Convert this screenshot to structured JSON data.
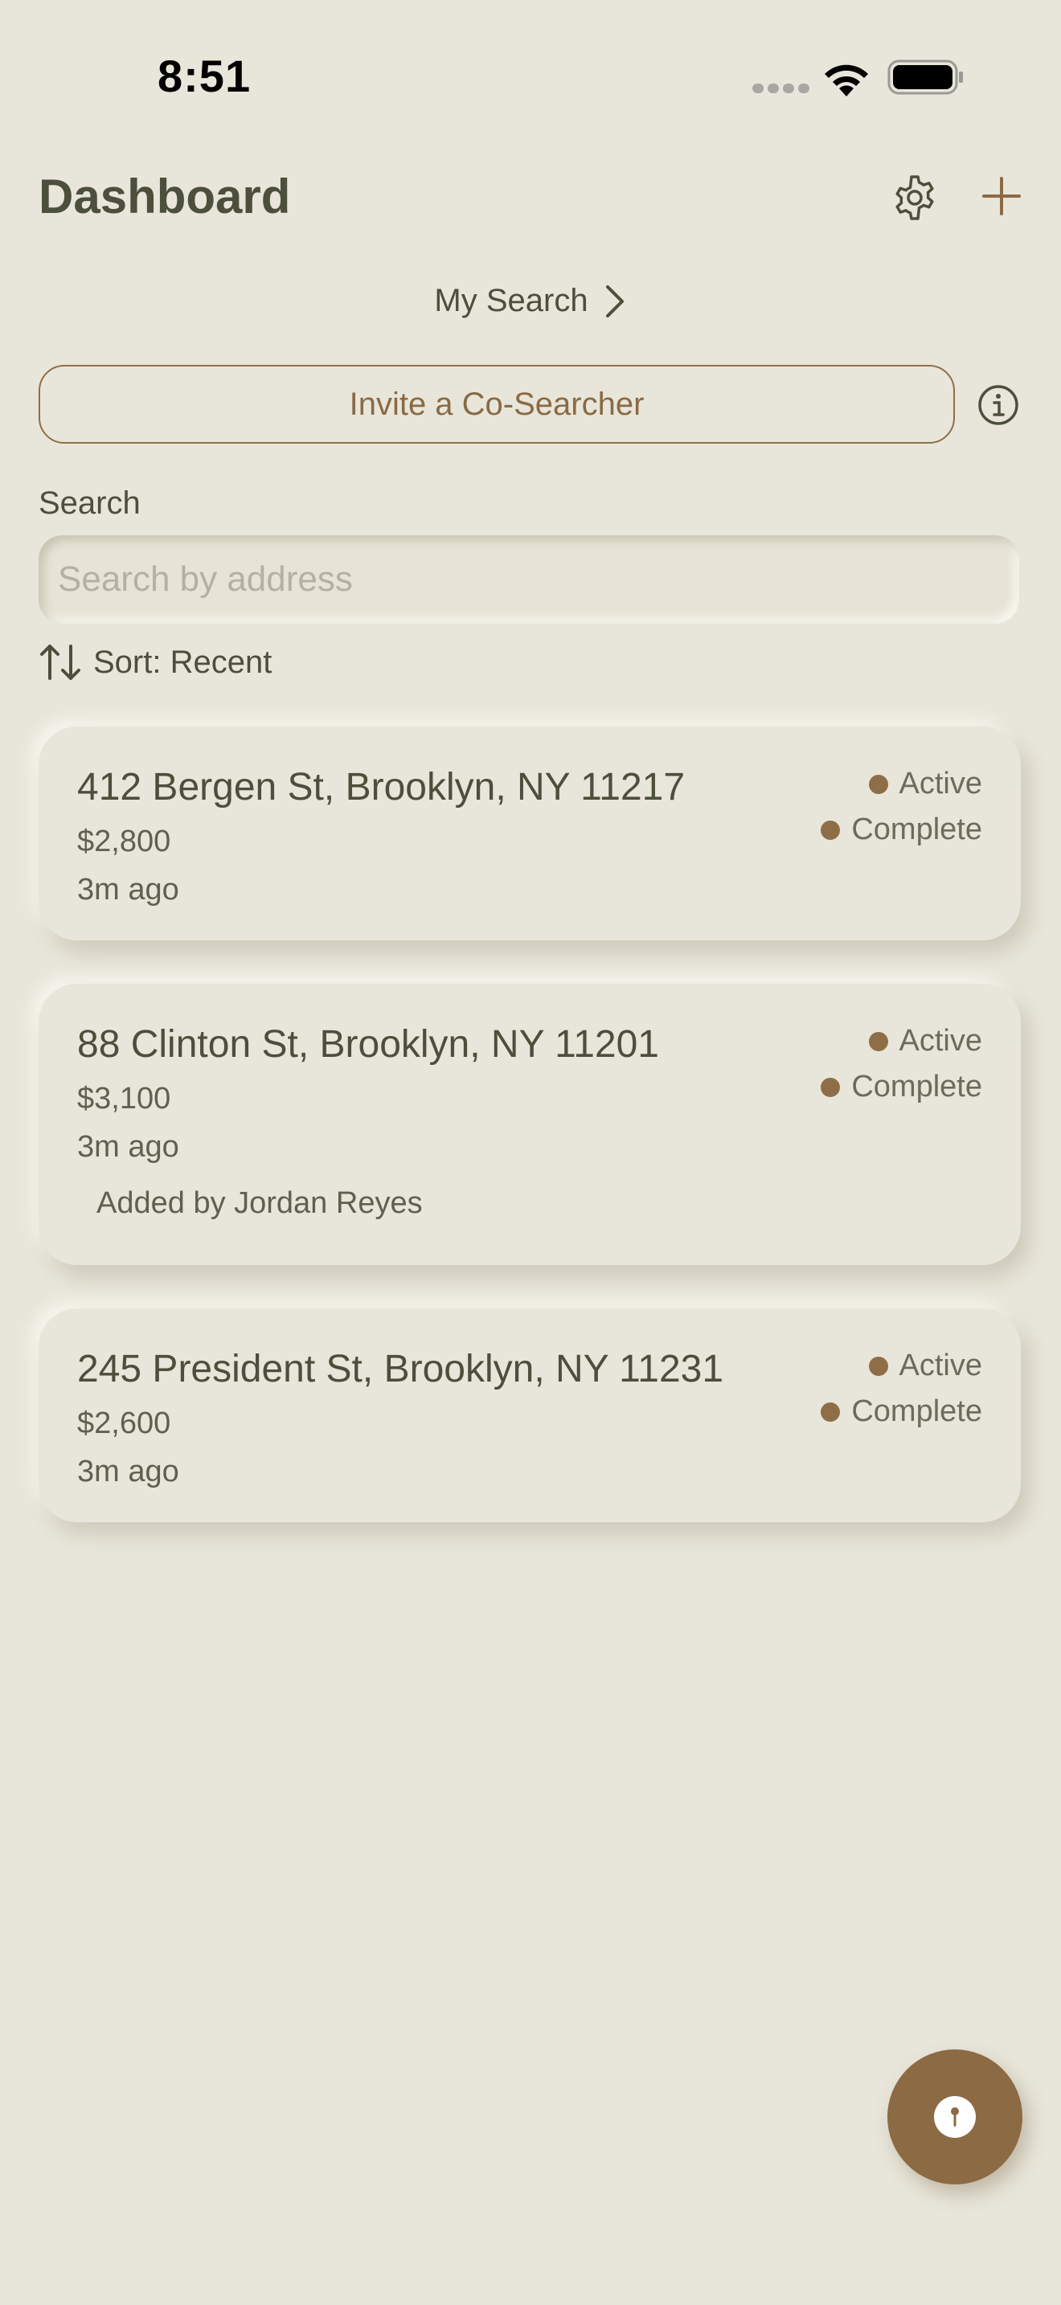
{
  "status_bar": {
    "time": "8:51"
  },
  "header": {
    "title": "Dashboard"
  },
  "my_search": {
    "label": "My Search"
  },
  "invite": {
    "label": "Invite a Co-Searcher"
  },
  "search": {
    "label": "Search",
    "placeholder": "Search by address",
    "value": ""
  },
  "sort": {
    "label": "Sort: Recent"
  },
  "listings": [
    {
      "address": "412 Bergen St, Brooklyn, NY 11217",
      "price": "$2,800",
      "time": "3m ago",
      "added_by": "",
      "badges": [
        "Active",
        "Complete"
      ]
    },
    {
      "address": "88 Clinton St, Brooklyn, NY 11201",
      "price": "$3,100",
      "time": "3m ago",
      "added_by": "Added by Jordan Reyes",
      "badges": [
        "Active",
        "Complete"
      ]
    },
    {
      "address": "245 President St, Brooklyn, NY 11231",
      "price": "$2,600",
      "time": "3m ago",
      "added_by": "",
      "badges": [
        "Active",
        "Complete"
      ]
    }
  ],
  "icons": {
    "settings": "gear-icon",
    "add": "plus-icon",
    "info": "info-icon",
    "sort": "sort-arrows-icon",
    "chevron": "chevron-right-icon",
    "fab": "pin-icon"
  },
  "colors": {
    "background": "#e8e6da",
    "accent": "#8c6a43",
    "text": "#4b4f3c"
  }
}
